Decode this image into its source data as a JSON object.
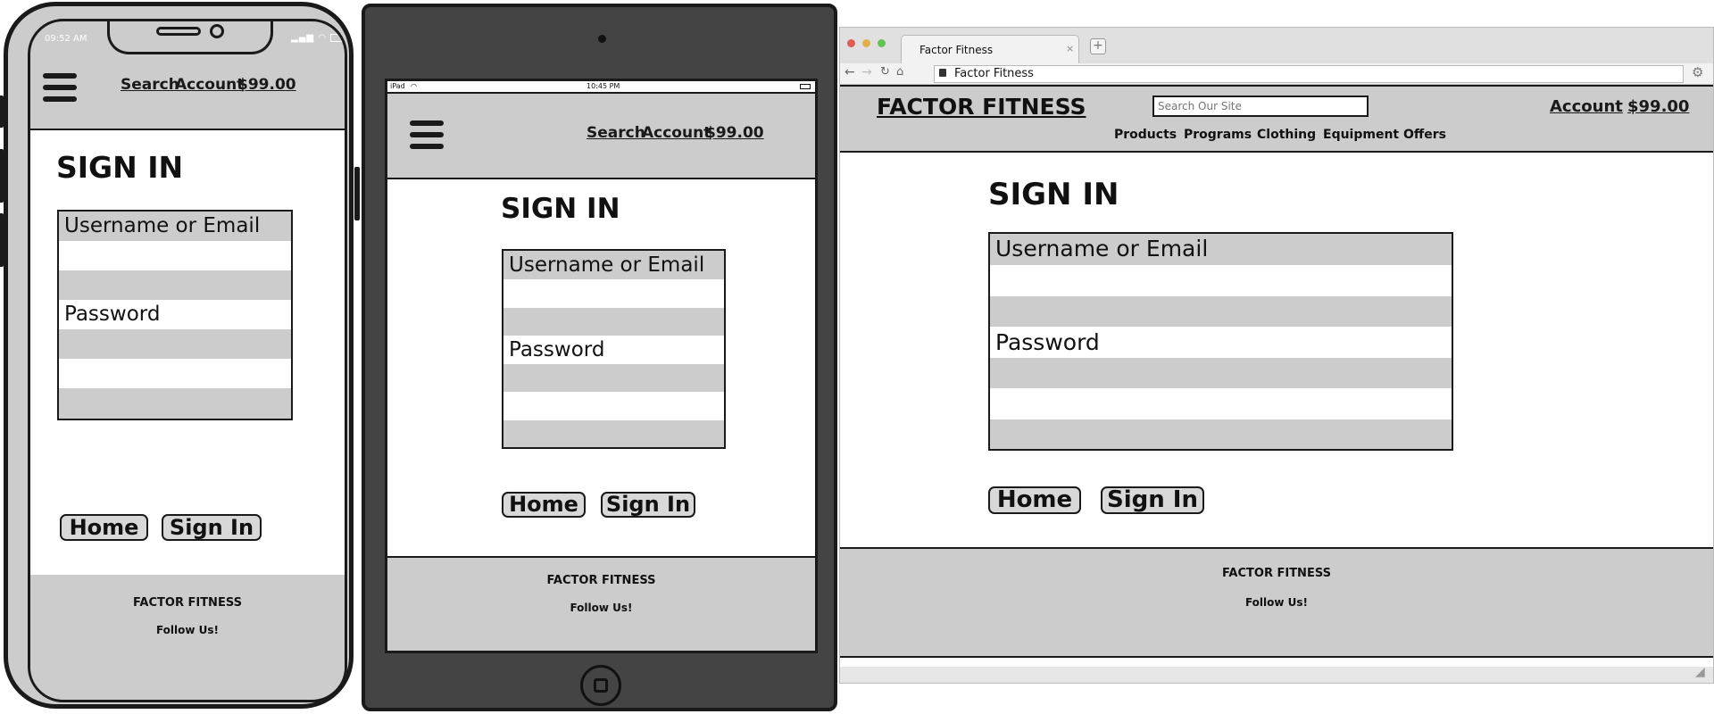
{
  "phone": {
    "status_time": "09:52 AM",
    "nav": {
      "search": "Search",
      "account": "Account",
      "cart": "$99.00"
    },
    "heading": "SIGN IN",
    "form": {
      "username_label": "Username or Email",
      "password_label": "Password"
    },
    "buttons": {
      "home": "Home",
      "sign_in": "Sign In"
    },
    "footer": {
      "brand": "FACTOR FITNESS",
      "follow": "Follow Us!"
    }
  },
  "tablet": {
    "status_device": "iPad",
    "status_time": "10:45 PM",
    "nav": {
      "search": "Search",
      "account": "Account",
      "cart": "$99.00"
    },
    "heading": "SIGN IN",
    "form": {
      "username_label": "Username or Email",
      "password_label": "Password"
    },
    "buttons": {
      "home": "Home",
      "sign_in": "Sign In"
    },
    "footer": {
      "brand": "FACTOR FITNESS",
      "follow": "Follow Us!"
    }
  },
  "browser": {
    "tab_title": "Factor Fitness",
    "address": "Factor Fitness",
    "header": {
      "logo": "FACTOR FITNESS",
      "search_placeholder": "Search Our Site",
      "account": "Account",
      "cart": "$99.00",
      "menu": [
        "Products",
        "Programs",
        "Clothing",
        "Equipment",
        "Offers"
      ]
    },
    "heading": "SIGN IN",
    "form": {
      "username_label": "Username or Email",
      "password_label": "Password"
    },
    "buttons": {
      "home": "Home",
      "sign_in": "Sign In"
    },
    "footer": {
      "brand": "FACTOR FITNESS",
      "follow": "Follow Us!"
    }
  }
}
